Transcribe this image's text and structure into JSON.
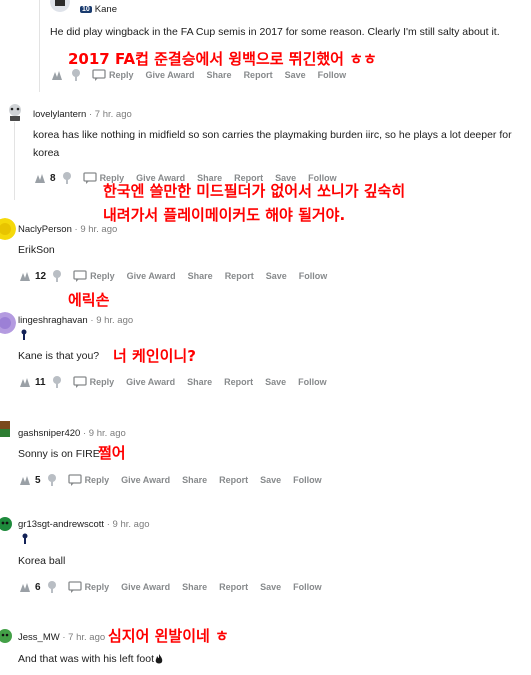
{
  "comments": [
    {
      "id": "c0",
      "user": "Kane",
      "flair": "10",
      "time": "",
      "text": "He did play wingback in the FA Cup semis in 2017 for some reason. Clearly I'm still salty about it.",
      "votes": "",
      "overlay": "2017 FA컵 준결승에서 윙백으로 뛰긴했어 ㅎㅎ"
    },
    {
      "id": "c1",
      "user": "lovelylantern",
      "time": "7 hr. ago",
      "text": "korea has like nothing in midfield so son carries the playmaking burden iirc, so he plays a lot deeper for korea",
      "votes": "8",
      "overlay_line1": "한국엔 쓸만한 미드필더가 없어서 쏘니가 깊숙히",
      "overlay_line2": "내려가서 플레이메이커도 해야 될거야."
    },
    {
      "id": "c2",
      "user": "NaclyPerson",
      "time": "9 hr. ago",
      "text": "ErikSon",
      "votes": "12",
      "overlay": "에릭손"
    },
    {
      "id": "c3",
      "user": "lingeshraghavan",
      "time": "9 hr. ago",
      "text": "Kane is that you?",
      "votes": "11",
      "overlay": "너 케인이니?"
    },
    {
      "id": "c4",
      "user": "gashsniper420",
      "time": "9 hr. ago",
      "text": "Sonny is on FIRE",
      "votes": "5",
      "overlay": "쩔어"
    },
    {
      "id": "c5",
      "user": "gr13sgt-andrewscott",
      "time": "9 hr. ago",
      "text": "Korea ball",
      "votes": "6",
      "overlay": ""
    },
    {
      "id": "c6",
      "user": "Jess_MW",
      "time": "7 hr. ago",
      "text": "And that was with his left foot",
      "votes": "",
      "overlay": "심지어 왼발이네 ㅎ"
    }
  ],
  "actions": {
    "reply": "Reply",
    "give_award": "Give Award",
    "share": "Share",
    "report": "Report",
    "save": "Save",
    "follow": "Follow"
  },
  "separator": "·",
  "colors": {
    "overlay_text": "#ff0000",
    "action_text": "#878a8c",
    "thread_line": "#e3e3e3",
    "flair_bg": "#1a3b6e"
  },
  "icons": [
    "upvote-icon",
    "spurs-rooster-icon",
    "speech-bubble-icon",
    "fire-icon",
    "avatar-icon"
  ]
}
